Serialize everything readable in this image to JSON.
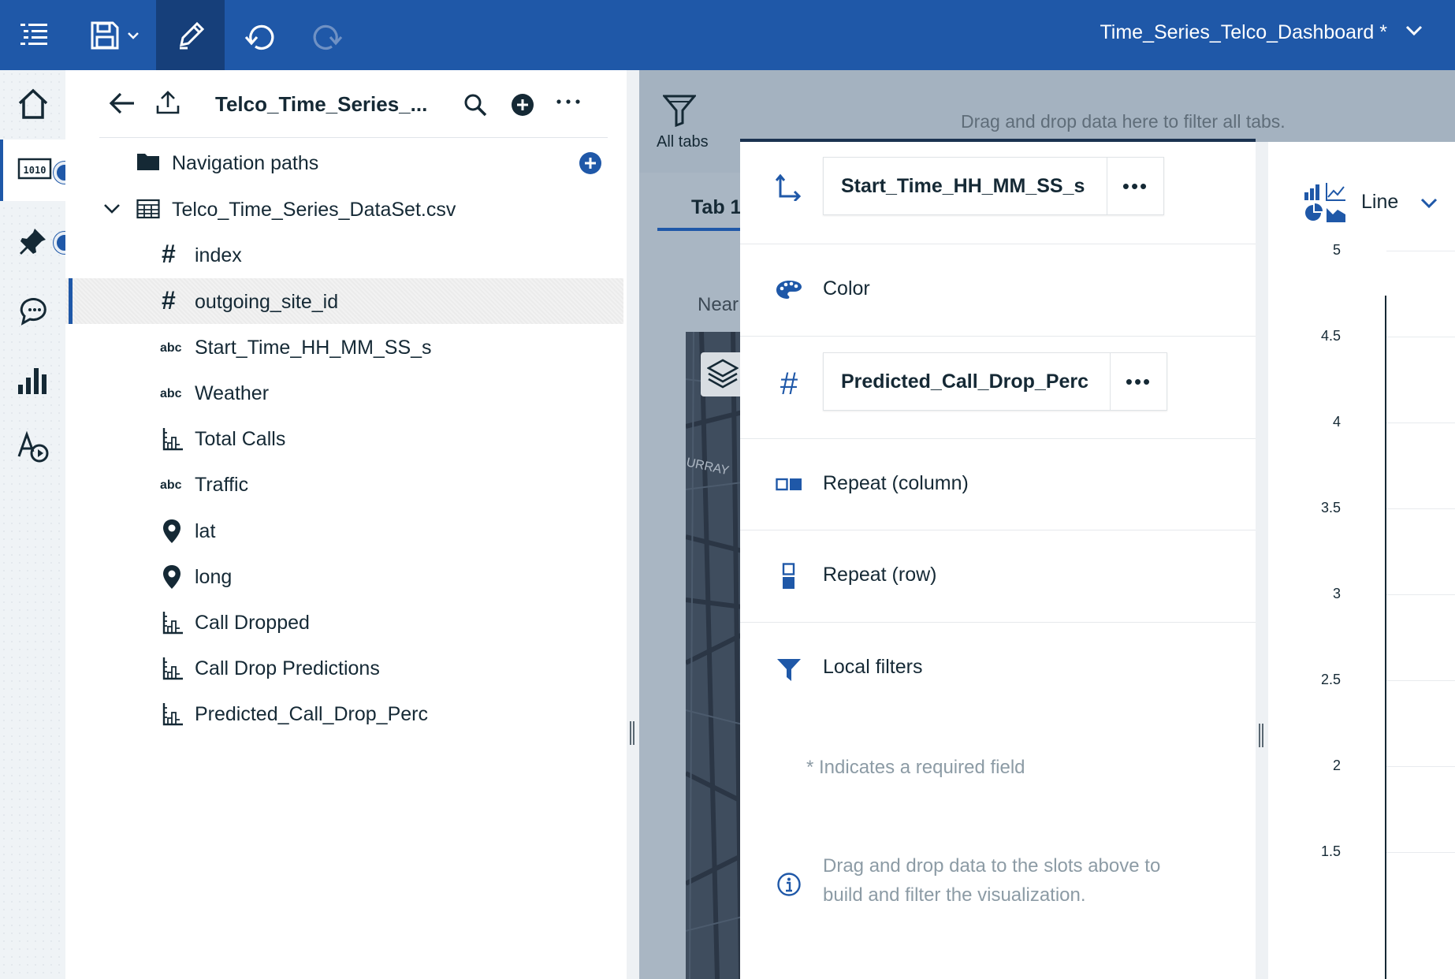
{
  "toolbar": {
    "dashboard_title": "Time_Series_Telco_Dashboard *"
  },
  "datapanel": {
    "source_title": "Telco_Time_Series_...",
    "tree": [
      {
        "type": "folder",
        "label": "Navigation paths"
      },
      {
        "type": "table",
        "label": "Telco_Time_Series_DataSet.csv"
      },
      {
        "type": "hash",
        "label": "index"
      },
      {
        "type": "hash",
        "label": "outgoing_site_id"
      },
      {
        "type": "abc",
        "label": "Start_Time_HH_MM_SS_s"
      },
      {
        "type": "abc",
        "label": "Weather"
      },
      {
        "type": "measure",
        "label": "Total Calls"
      },
      {
        "type": "abc",
        "label": "Traffic"
      },
      {
        "type": "geo",
        "label": "lat"
      },
      {
        "type": "geo",
        "label": "long"
      },
      {
        "type": "measure",
        "label": "Call Dropped"
      },
      {
        "type": "measure",
        "label": "Call Drop Predictions"
      },
      {
        "type": "measure",
        "label": "Predicted_Call_Drop_Perc"
      }
    ],
    "abc_marker": "abc",
    "hash_marker": "#"
  },
  "canvas": {
    "all_tabs_label": "All tabs",
    "filter_drop_text": "Drag and drop data here to filter all tabs.",
    "tab_label": "Tab 1",
    "partial_title": "Near"
  },
  "slots": {
    "x_axis_value": "Start_Time_HH_MM_SS_s",
    "color_label": "Color",
    "y_value": "Predicted_Call_Drop_Perc",
    "y_marker": "#",
    "repeat_column_label": "Repeat (column)",
    "repeat_row_label": "Repeat (row)",
    "local_filters_label": "Local filters",
    "required_note": "* Indicates a required field",
    "info_text": "Drag and drop data to the slots above to build and filter the visualization.",
    "more_label": "•••"
  },
  "chart": {
    "visualization_type": "Line",
    "y_ticks": [
      "5",
      "4.5",
      "4",
      "3.5",
      "3",
      "2.5",
      "2",
      "1.5"
    ]
  },
  "colors": {
    "brand_blue": "#1f58a8",
    "toolbar_active": "#163f7a",
    "canvas_gray": "#a9b6c3",
    "text_dark": "#152935",
    "hint_gray": "#8c9ba5"
  }
}
